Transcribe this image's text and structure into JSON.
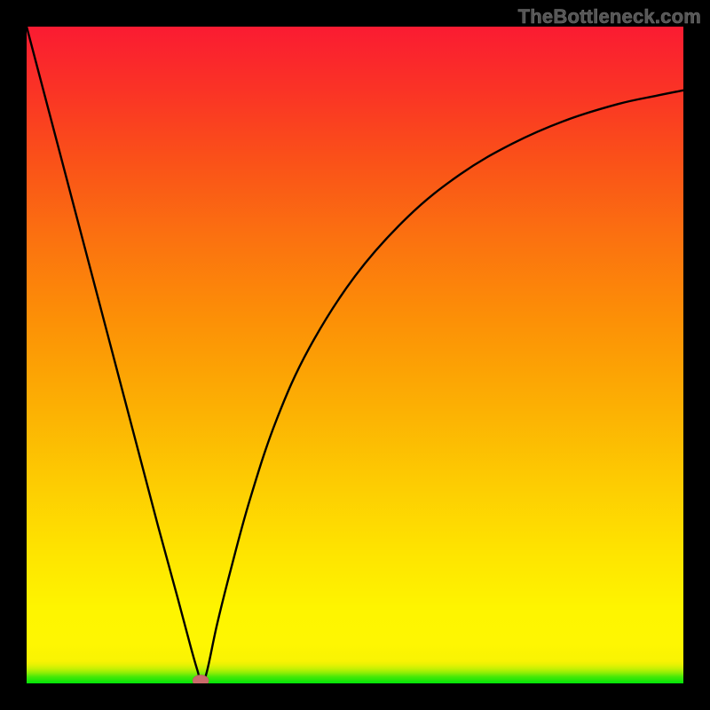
{
  "watermark": "TheBottleneck.com",
  "chart_data": {
    "type": "line",
    "title": "",
    "xlabel": "",
    "ylabel": "",
    "xlim": [
      0,
      1
    ],
    "ylim": [
      0,
      1
    ],
    "series": [
      {
        "name": "bottleneck-curve",
        "x": [
          0.0,
          0.05,
          0.1,
          0.15,
          0.2,
          0.23,
          0.25,
          0.26,
          0.267,
          0.275,
          0.29,
          0.31,
          0.34,
          0.38,
          0.43,
          0.5,
          0.58,
          0.66,
          0.74,
          0.82,
          0.9,
          0.96,
          1.0
        ],
        "y": [
          1.0,
          0.81,
          0.62,
          0.43,
          0.24,
          0.13,
          0.055,
          0.02,
          0.0,
          0.02,
          0.09,
          0.17,
          0.28,
          0.4,
          0.51,
          0.62,
          0.71,
          0.775,
          0.822,
          0.857,
          0.882,
          0.895,
          0.903
        ]
      },
      {
        "name": "marker-dot",
        "x": [
          0.265
        ],
        "y": [
          0.004
        ]
      }
    ],
    "marker_color": "#c96a6a",
    "curve_color": "#000000"
  }
}
